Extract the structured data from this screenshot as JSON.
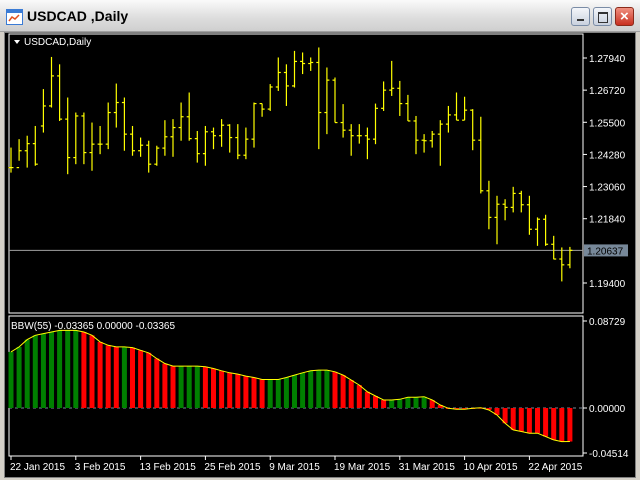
{
  "window": {
    "title": "USDCAD ,Daily"
  },
  "chart": {
    "label": "USDCAD,Daily",
    "price_labels": [
      "1.27940",
      "1.26720",
      "1.25500",
      "1.24280",
      "1.23060",
      "1.21840",
      "1.19400"
    ],
    "price_values": [
      1.2794,
      1.2672,
      1.255,
      1.2428,
      1.2306,
      1.2184,
      1.194
    ],
    "current_price": "1.20637",
    "current_price_value": 1.20637,
    "colors": {
      "bars": "#ffff00",
      "background": "#000000",
      "current_line": "#a0a0a0",
      "up": "#008000",
      "down": "#ff0000"
    },
    "ohlc": [
      [
        1.2378,
        1.2454,
        1.2359,
        1.2378
      ],
      [
        1.2378,
        1.2486,
        1.2404,
        1.2442
      ],
      [
        1.2442,
        1.2499,
        1.2378,
        1.2469
      ],
      [
        1.2469,
        1.2536,
        1.2385,
        1.2391
      ],
      [
        1.2536,
        1.2676,
        1.2511,
        1.2612
      ],
      [
        1.2612,
        1.2798,
        1.2606,
        1.2726
      ],
      [
        1.2726,
        1.277,
        1.2555,
        1.2562
      ],
      [
        1.2562,
        1.2644,
        1.2353,
        1.2416
      ],
      [
        1.2416,
        1.2587,
        1.2391,
        1.2574
      ],
      [
        1.2574,
        1.2587,
        1.2391,
        1.2435
      ],
      [
        1.2435,
        1.2549,
        1.2366,
        1.2467
      ],
      [
        1.2467,
        1.2536,
        1.2429,
        1.2467
      ],
      [
        1.2467,
        1.2625,
        1.2448,
        1.2587
      ],
      [
        1.2587,
        1.2697,
        1.253,
        1.2625
      ],
      [
        1.2625,
        1.2644,
        1.2442,
        1.2505
      ],
      [
        1.2505,
        1.2536,
        1.2423,
        1.2442
      ],
      [
        1.2442,
        1.2492,
        1.2419,
        1.2463
      ],
      [
        1.2463,
        1.248,
        1.2359,
        1.2391
      ],
      [
        1.2391,
        1.2461,
        1.2385,
        1.2452
      ],
      [
        1.2452,
        1.2558,
        1.2423,
        1.2495
      ],
      [
        1.2495,
        1.2562,
        1.2419,
        1.253
      ],
      [
        1.253,
        1.2625,
        1.248,
        1.2571
      ],
      [
        1.2571,
        1.2663,
        1.248,
        1.2488
      ],
      [
        1.2488,
        1.2517,
        1.2397,
        1.2431
      ],
      [
        1.2431,
        1.2536,
        1.2385,
        1.2514
      ],
      [
        1.2514,
        1.253,
        1.2448,
        1.2499
      ],
      [
        1.2499,
        1.2562,
        1.2457,
        1.2539
      ],
      [
        1.2539,
        1.2543,
        1.2435,
        1.2492
      ],
      [
        1.2492,
        1.2543,
        1.241,
        1.2425
      ],
      [
        1.2425,
        1.253,
        1.241,
        1.2486
      ],
      [
        1.2486,
        1.2625,
        1.2454,
        1.2621
      ],
      [
        1.2621,
        1.2621,
        1.2571,
        1.26
      ],
      [
        1.26,
        1.2695,
        1.2593,
        1.2684
      ],
      [
        1.2684,
        1.2796,
        1.2669,
        1.2739
      ],
      [
        1.2739,
        1.277,
        1.2612,
        1.2688
      ],
      [
        1.2688,
        1.2821,
        1.2682,
        1.2781
      ],
      [
        1.2781,
        1.2815,
        1.2733,
        1.2773
      ],
      [
        1.2773,
        1.2796,
        1.2745,
        1.2777
      ],
      [
        1.2777,
        1.2834,
        1.2448,
        1.2587
      ],
      [
        1.2587,
        1.2758,
        1.2505,
        1.271
      ],
      [
        1.271,
        1.272,
        1.2549,
        1.2549
      ],
      [
        1.2549,
        1.2619,
        1.2492,
        1.252
      ],
      [
        1.252,
        1.2543,
        1.2423,
        1.2499
      ],
      [
        1.2499,
        1.2543,
        1.2469,
        1.2499
      ],
      [
        1.2499,
        1.253,
        1.241,
        1.2486
      ],
      [
        1.2486,
        1.2621,
        1.2467,
        1.2603
      ],
      [
        1.2603,
        1.2705,
        1.2593,
        1.2672
      ],
      [
        1.2672,
        1.2783,
        1.265,
        1.2679
      ],
      [
        1.2679,
        1.2707,
        1.2574,
        1.2621
      ],
      [
        1.2621,
        1.2654,
        1.2555,
        1.2555
      ],
      [
        1.2555,
        1.2574,
        1.2429,
        1.2482
      ],
      [
        1.2482,
        1.2505,
        1.2435,
        1.248
      ],
      [
        1.248,
        1.2517,
        1.2454,
        1.2505
      ],
      [
        1.2505,
        1.2558,
        1.2385,
        1.2543
      ],
      [
        1.2543,
        1.2612,
        1.2511,
        1.2578
      ],
      [
        1.2578,
        1.2663,
        1.2558,
        1.2558
      ],
      [
        1.2558,
        1.2647,
        1.2558,
        1.2596
      ],
      [
        1.2596,
        1.26,
        1.2444,
        1.2482
      ],
      [
        1.2482,
        1.2571,
        1.228,
        1.229
      ],
      [
        1.229,
        1.2328,
        1.2144,
        1.2189
      ],
      [
        1.2189,
        1.2271,
        1.2087,
        1.2239
      ],
      [
        1.2239,
        1.2258,
        1.2178,
        1.2227
      ],
      [
        1.2227,
        1.2305,
        1.2208,
        1.228
      ],
      [
        1.228,
        1.229,
        1.2208,
        1.2237
      ],
      [
        1.2237,
        1.2271,
        1.2123,
        1.2144
      ],
      [
        1.2144,
        1.2189,
        1.2081,
        1.2182
      ],
      [
        1.2182,
        1.2199,
        1.2081,
        1.2087
      ],
      [
        1.2087,
        1.2119,
        1.203,
        1.2031
      ],
      [
        1.2031,
        1.2075,
        1.1946,
        1.2009
      ],
      [
        1.2009,
        1.2077,
        1.1996,
        1.2064
      ]
    ]
  },
  "indicator": {
    "label": "BBW(55) -0.03365 0.00000 -0.03365",
    "scale_labels": [
      "0.08729",
      "0.00000",
      "-0.04514"
    ],
    "scale_values": [
      0.08729,
      0.0,
      -0.04514
    ],
    "values": [
      0.0563,
      0.0613,
      0.0686,
      0.0729,
      0.0746,
      0.0763,
      0.0779,
      0.0779,
      0.0779,
      0.0763,
      0.0729,
      0.0663,
      0.0629,
      0.0613,
      0.0613,
      0.0606,
      0.0579,
      0.0553,
      0.0496,
      0.0446,
      0.042,
      0.042,
      0.042,
      0.042,
      0.0413,
      0.0396,
      0.0373,
      0.0353,
      0.034,
      0.032,
      0.0306,
      0.0286,
      0.0286,
      0.0286,
      0.0306,
      0.033,
      0.0353,
      0.0373,
      0.038,
      0.038,
      0.0363,
      0.033,
      0.028,
      0.023,
      0.0163,
      0.012,
      0.008,
      0.008,
      0.0087,
      0.0107,
      0.0107,
      0.0113,
      0.008,
      0.003,
      -0.0003,
      -0.0013,
      -0.0013,
      -0.0003,
      0.0003,
      -0.002,
      -0.007,
      -0.0153,
      -0.022,
      -0.0236,
      -0.0253,
      -0.0253,
      -0.0286,
      -0.032,
      -0.0337,
      -0.03365
    ]
  },
  "time_axis": {
    "labels": [
      "22 Jan 2015",
      "3 Feb 2015",
      "13 Feb 2015",
      "25 Feb 2015",
      "9 Mar 2015",
      "19 Mar 2015",
      "31 Mar 2015",
      "10 Apr 2015",
      "22 Apr 2015"
    ],
    "bar_index": [
      0,
      8,
      16,
      24,
      32,
      40,
      48,
      56,
      64
    ]
  }
}
